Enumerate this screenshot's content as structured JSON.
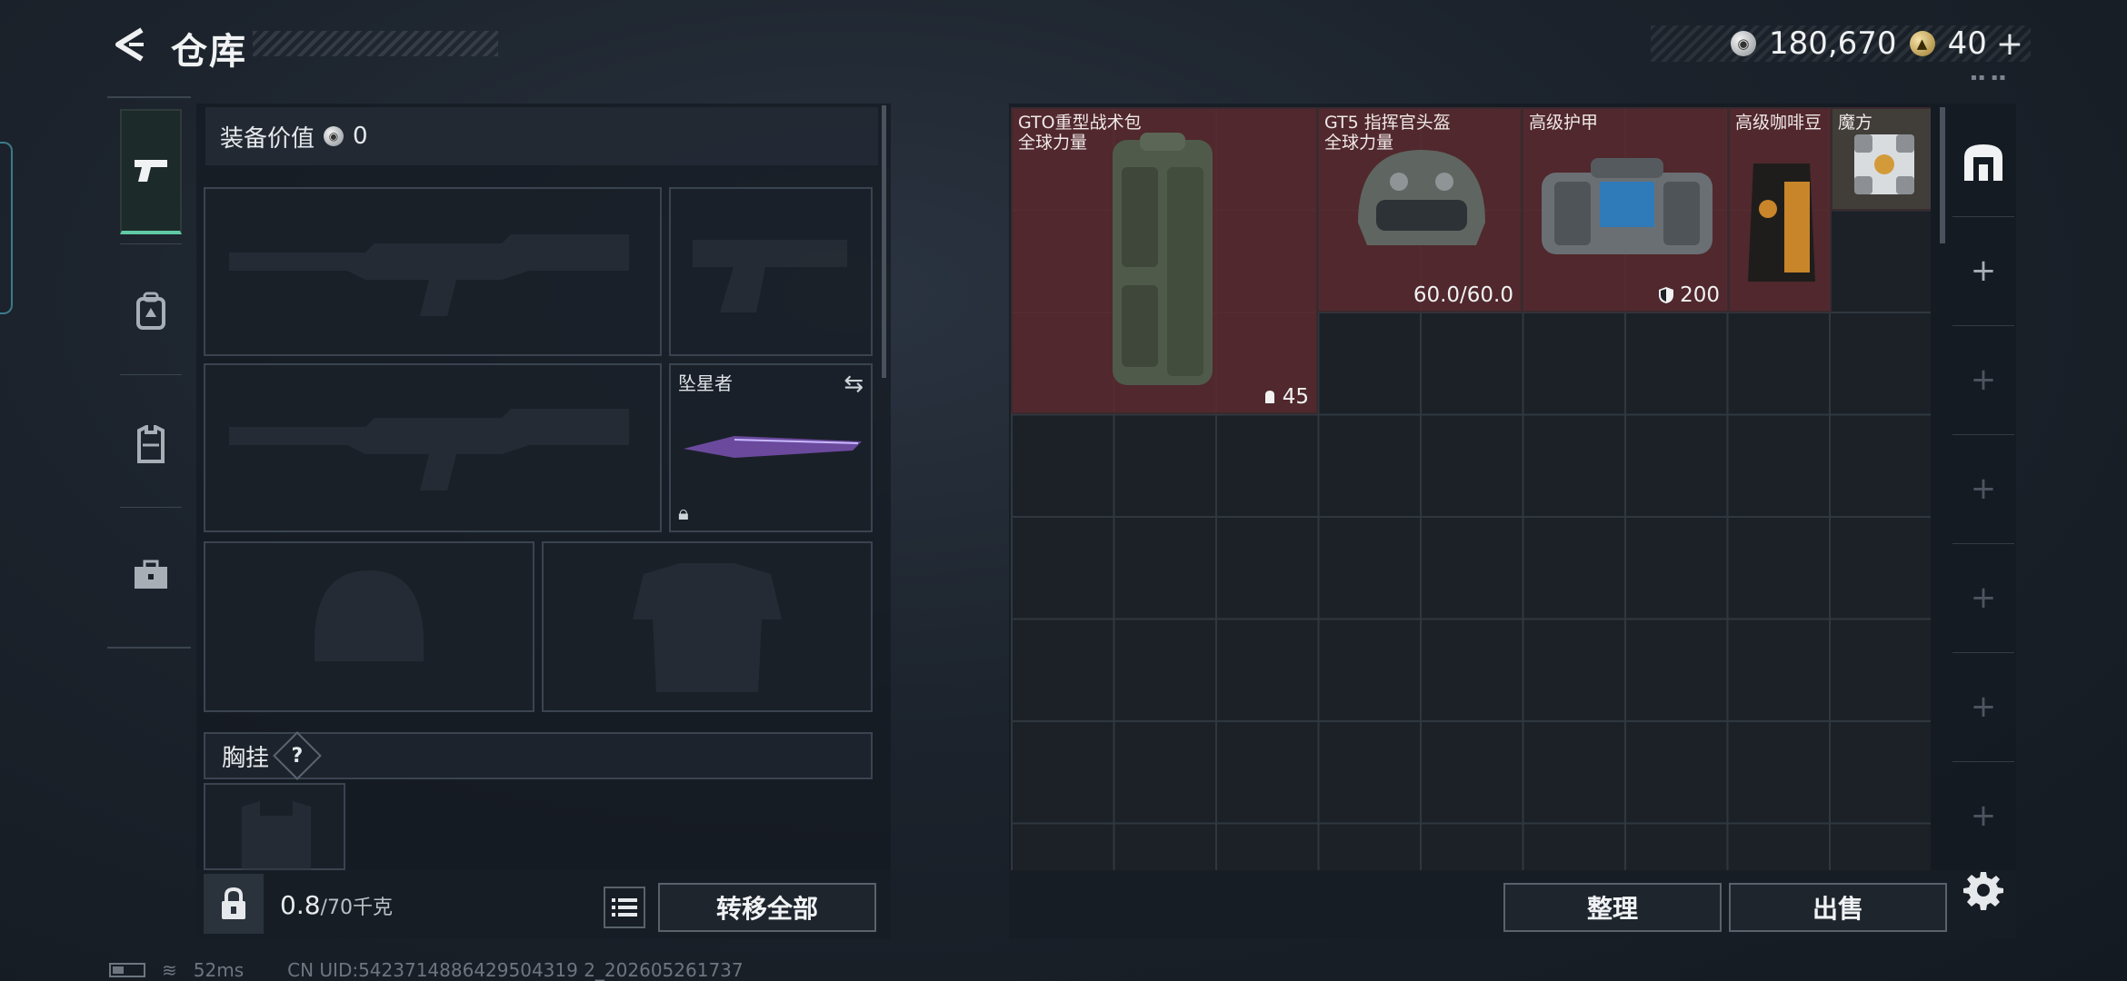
{
  "header": {
    "title": "仓库",
    "currency": [
      {
        "icon": "silver-coin-icon",
        "value": "180,670"
      },
      {
        "icon": "gold-coin-icon",
        "value": "40"
      }
    ],
    "add_symbol": "+",
    "dots": "▪▪ ▪▪"
  },
  "equipment": {
    "value_label": "装备价值",
    "value": "0",
    "melee_slot": {
      "name": "坠星者"
    },
    "chest_rig_label": "胸挂",
    "help_symbol": "?"
  },
  "footer_left": {
    "weight_current": "0.8",
    "weight_max": "/70千克",
    "transfer_all_label": "转移全部"
  },
  "storage": {
    "items": [
      {
        "name": "GTO重型战术包\n全球力量",
        "stat": "45",
        "stat_icon": "capacity-icon"
      },
      {
        "name": "GT5 指挥官头盔\n全球力量",
        "stat": "60.0/60.0",
        "stat_icon": ""
      },
      {
        "name": "高级护甲",
        "stat": "200",
        "stat_icon": "shield-icon"
      },
      {
        "name": "高级咖啡豆",
        "stat": "",
        "stat_icon": ""
      },
      {
        "name": "魔方",
        "stat": "",
        "stat_icon": ""
      }
    ],
    "sort_label": "整理",
    "sell_label": "出售",
    "tab_plus": "+"
  },
  "status_bar": {
    "ping": "52ms",
    "uid": "CN UID:5423714886429504319 2_202605261737"
  },
  "colors": {
    "accent_green": "#5fcaa4",
    "item_bg": "#5c2a2e"
  }
}
